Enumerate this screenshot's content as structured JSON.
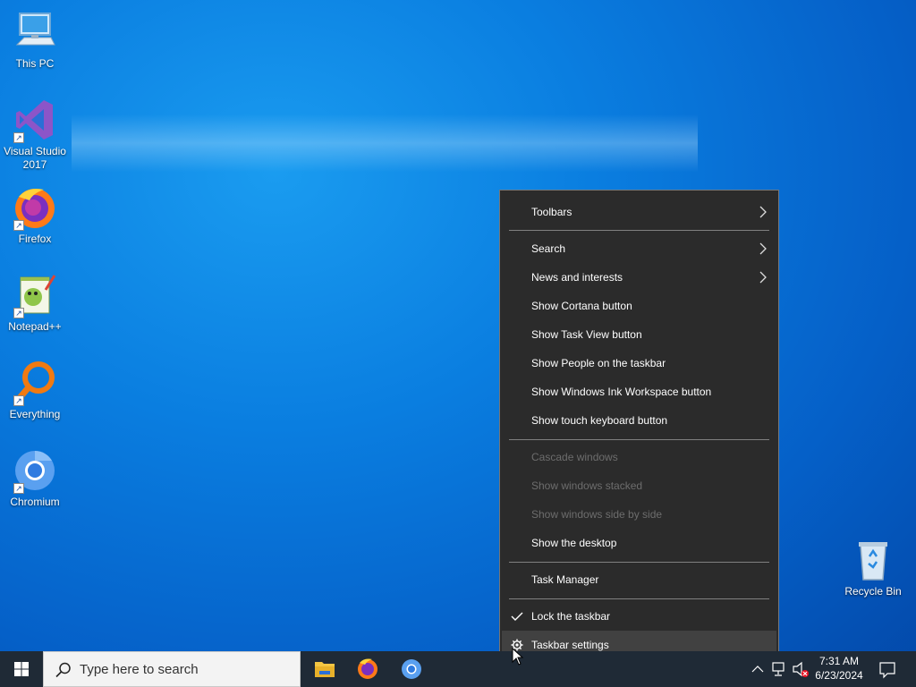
{
  "desktop": {
    "icons": [
      {
        "label": "This PC",
        "icon": "this-pc-icon"
      },
      {
        "label": "Visual Studio 2017",
        "icon": "visual-studio-icon"
      },
      {
        "label": "Firefox",
        "icon": "firefox-icon"
      },
      {
        "label": "Notepad++",
        "icon": "notepadpp-icon"
      },
      {
        "label": "Everything",
        "icon": "everything-icon"
      },
      {
        "label": "Chromium",
        "icon": "chromium-icon"
      }
    ],
    "recycle_bin": {
      "label": "Recycle Bin",
      "icon": "recycle-bin-icon"
    }
  },
  "context_menu": {
    "items": [
      {
        "label": "Toolbars",
        "submenu": true
      },
      {
        "label": "Search",
        "submenu": true
      },
      {
        "label": "News and interests",
        "submenu": true
      },
      {
        "label": "Show Cortana button"
      },
      {
        "label": "Show Task View button"
      },
      {
        "label": "Show People on the taskbar"
      },
      {
        "label": "Show Windows Ink Workspace button"
      },
      {
        "label": "Show touch keyboard button"
      },
      {
        "label": "Cascade windows",
        "disabled": true
      },
      {
        "label": "Show windows stacked",
        "disabled": true
      },
      {
        "label": "Show windows side by side",
        "disabled": true
      },
      {
        "label": "Show the desktop"
      },
      {
        "label": "Task Manager"
      },
      {
        "label": "Lock the taskbar",
        "checked": true
      },
      {
        "label": "Taskbar settings",
        "icon": "gear-icon",
        "hovered": true
      }
    ]
  },
  "taskbar": {
    "search_placeholder": "Type here to search",
    "pinned": [
      "file-explorer-icon",
      "firefox-icon",
      "chromium-icon"
    ],
    "clock_time": "7:31 AM",
    "clock_date": "6/23/2024",
    "tray": [
      "chevron-up-icon",
      "network-icon",
      "volume-muted-icon",
      "notifications-icon"
    ]
  },
  "colors": {
    "menu_bg": "#2b2b2b",
    "menu_hover": "#414141",
    "taskbar_bg": "#1f2a36",
    "desktop_accent": "#0a7ee0"
  }
}
